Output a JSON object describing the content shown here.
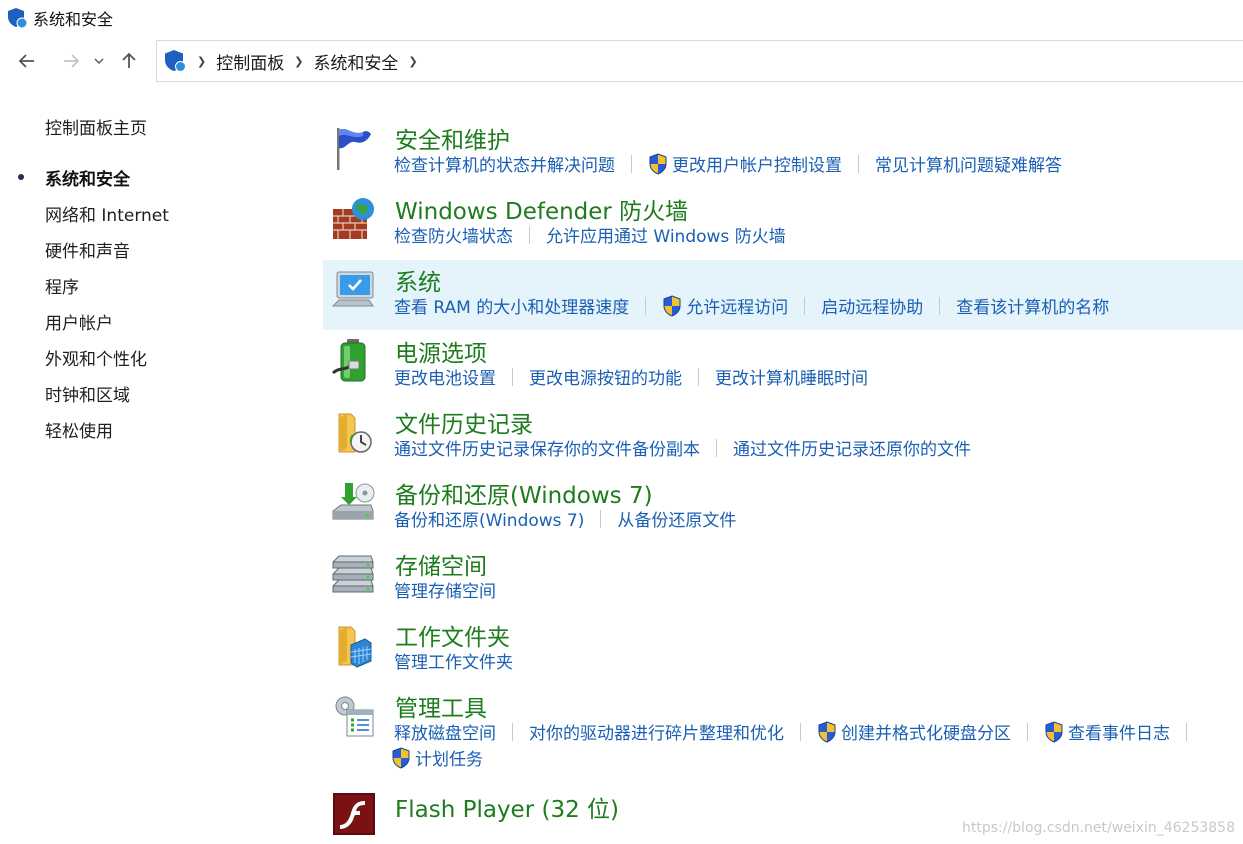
{
  "window": {
    "title": "系统和安全"
  },
  "nav": {
    "back_icon": "back-arrow-icon",
    "forward_icon": "forward-arrow-icon",
    "recent_icon": "chevron-down-icon",
    "up_icon": "up-arrow-icon",
    "breadcrumbs": [
      "控制面板",
      "系统和安全"
    ]
  },
  "sidebar": {
    "home": "控制面板主页",
    "items": [
      "系统和安全",
      "网络和 Internet",
      "硬件和声音",
      "程序",
      "用户帐户",
      "外观和个性化",
      "时钟和区域",
      "轻松使用"
    ],
    "current": "系统和安全"
  },
  "sections": [
    {
      "title": "安全和维护",
      "icon": "security-flag-icon",
      "links": [
        "检查计算机的状态并解决问题",
        "更改用户帐户控制设置",
        "常见计算机问题疑难解答"
      ]
    },
    {
      "title": "Windows Defender 防火墙",
      "icon": "firewall-icon",
      "links": [
        "检查防火墙状态",
        "允许应用通过 Windows 防火墙"
      ]
    },
    {
      "title": "系统",
      "icon": "system-computer-icon",
      "links": [
        "查看 RAM 的大小和处理器速度",
        "允许远程访问",
        "启动远程协助",
        "查看该计算机的名称"
      ]
    },
    {
      "title": "电源选项",
      "icon": "battery-power-icon",
      "links": [
        "更改电池设置",
        "更改电源按钮的功能",
        "更改计算机睡眠时间"
      ]
    },
    {
      "title": "文件历史记录",
      "icon": "file-history-icon",
      "links": [
        "通过文件历史记录保存你的文件备份副本",
        "通过文件历史记录还原你的文件"
      ]
    },
    {
      "title": "备份和还原(Windows 7)",
      "icon": "backup-restore-icon",
      "links": [
        "备份和还原(Windows 7)",
        "从备份还原文件"
      ]
    },
    {
      "title": "存储空间",
      "icon": "storage-spaces-icon",
      "links": [
        "管理存储空间"
      ]
    },
    {
      "title": "工作文件夹",
      "icon": "work-folders-icon",
      "links": [
        "管理工作文件夹"
      ]
    },
    {
      "title": "管理工具",
      "icon": "admin-tools-icon",
      "links": [
        "释放磁盘空间",
        "对你的驱动器进行碎片整理和优化",
        "创建并格式化硬盘分区",
        "查看事件日志",
        "计划任务"
      ]
    },
    {
      "title": "Flash Player (32 位)",
      "icon": "flash-player-icon",
      "links": []
    }
  ],
  "watermark": "https://blog.csdn.net/weixin_46253858",
  "colors": {
    "title_green": "#1e7c1e",
    "link_blue": "#1a5fb4",
    "hover_bg": "#e5f3fb"
  }
}
